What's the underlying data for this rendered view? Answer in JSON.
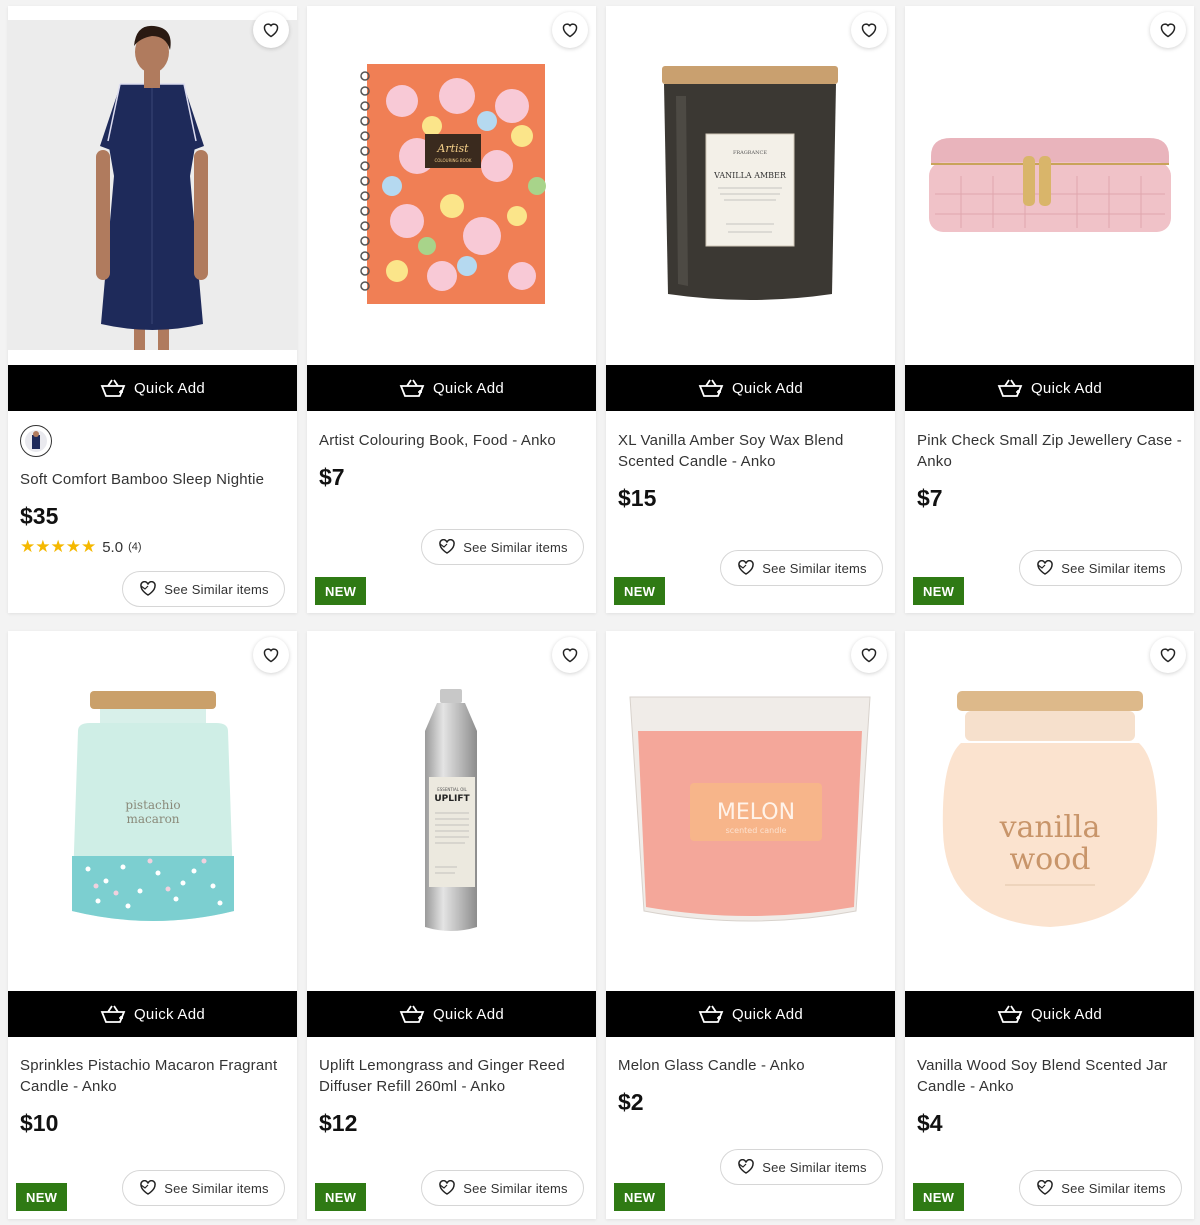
{
  "quick_add_label": "Quick Add",
  "see_similar_label": "See Similar items",
  "new_badge": "NEW",
  "products": [
    {
      "title": "Soft Comfort Bamboo Sleep Nightie",
      "price": "$35",
      "rating": "5.0",
      "rating_count": "(4)",
      "has_swatch": true,
      "is_new": false
    },
    {
      "title": "Artist Colouring Book, Food - Anko",
      "price": "$7",
      "is_new": true
    },
    {
      "title": "XL Vanilla Amber Soy Wax Blend Scented Candle - Anko",
      "price": "$15",
      "is_new": true,
      "candle_label": "VANILLA AMBER"
    },
    {
      "title": "Pink Check Small Zip Jewellery Case - Anko",
      "price": "$7",
      "is_new": true
    },
    {
      "title": "Sprinkles Pistachio Macaron Fragrant Candle - Anko",
      "price": "$10",
      "is_new": true,
      "candle_label_1": "pistachio",
      "candle_label_2": "macaron"
    },
    {
      "title": "Uplift Lemongrass and Ginger Reed Diffuser Refill 260ml - Anko",
      "price": "$12",
      "is_new": true,
      "bottle_label": "UPLIFT"
    },
    {
      "title": "Melon Glass Candle - Anko",
      "price": "$2",
      "is_new": true,
      "candle_label_1": "MELON",
      "candle_label_2": "scented candle"
    },
    {
      "title": "Vanilla Wood Soy Blend Scented Jar Candle - Anko",
      "price": "$4",
      "is_new": true,
      "candle_label_1": "vanilla",
      "candle_label_2": "wood"
    }
  ],
  "colors": {
    "new_badge": "#2f7a14",
    "quick_add_bg": "#000000",
    "star": "#f5b800"
  }
}
